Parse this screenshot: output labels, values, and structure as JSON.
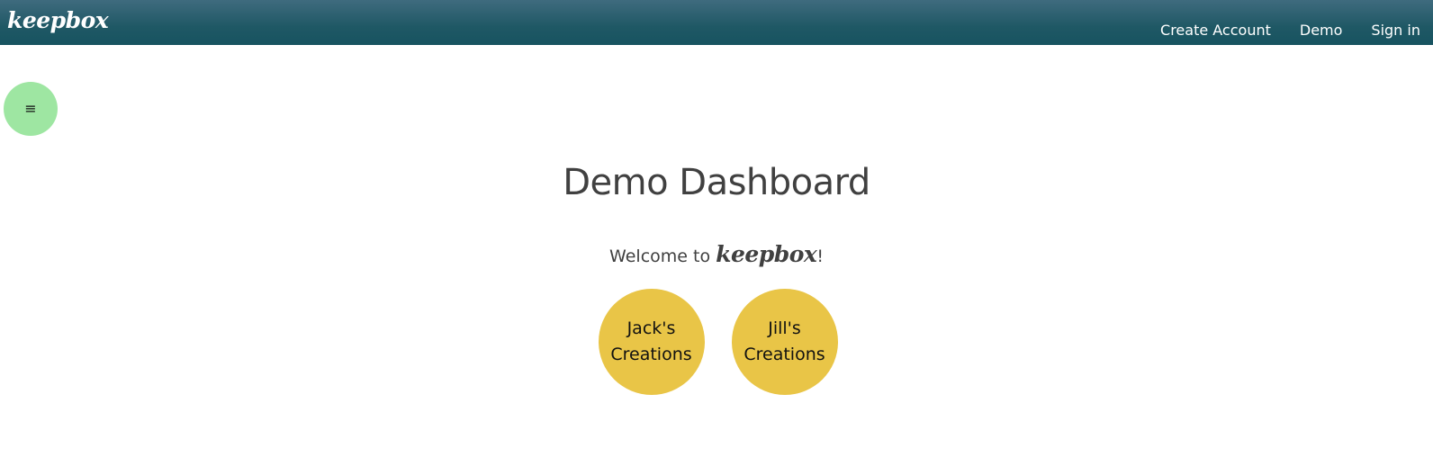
{
  "navbar": {
    "brand": "keepbox",
    "links": [
      {
        "label": "Create Account"
      },
      {
        "label": "Demo"
      },
      {
        "label": "Sign in"
      }
    ]
  },
  "menu_toggle": {
    "icon": "hamburger-icon",
    "glyph": "≡"
  },
  "main": {
    "title": "Demo Dashboard",
    "welcome_prefix": "Welcome to ",
    "welcome_brand": "keepbox",
    "welcome_suffix": "!",
    "creations": [
      {
        "label": "Jack's Creations"
      },
      {
        "label": "Jill's Creations"
      }
    ]
  },
  "colors": {
    "navbar_top": "#3f6b7e",
    "navbar_bottom": "#175360",
    "menu_toggle_bg": "#9ee6a2",
    "creation_bg": "#e9c547",
    "heading_text": "#404040"
  }
}
